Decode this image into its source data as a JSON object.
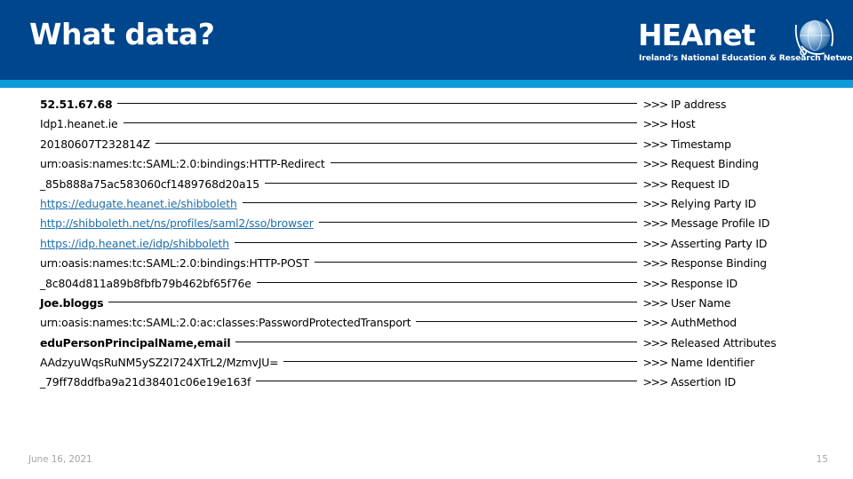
{
  "header": {
    "title": "What data?",
    "background_color": "#00468c",
    "accent_color": "#0d9bd7"
  },
  "logo": {
    "wordmark": "HEAnet",
    "tagline": "Ireland's National Education & Research Network",
    "icon": "globe-icon"
  },
  "rows": [
    {
      "value": "52.51.67.68",
      "style": "bold",
      "arrow": ">>>",
      "label": "IP address"
    },
    {
      "value": "Idp1.heanet.ie",
      "style": "normal",
      "arrow": ">>>",
      "label": "Host"
    },
    {
      "value": "20180607T232814Z",
      "style": "normal",
      "arrow": ">>>",
      "label": "Timestamp"
    },
    {
      "value": "urn:oasis:names:tc:SAML:2.0:bindings:HTTP-Redirect",
      "style": "normal",
      "arrow": ">>>",
      "label": " Request Binding"
    },
    {
      "value": "_85b888a75ac583060cf1489768d20a15",
      "style": "normal",
      "arrow": ">>>",
      "label": "Request ID"
    },
    {
      "value": "https://edugate.heanet.ie/shibboleth",
      "style": "link",
      "arrow": ">>>",
      "label": "Relying Party ID"
    },
    {
      "value": "http://shibboleth.net/ns/profiles/saml2/sso/browser",
      "style": "link",
      "arrow": ">>>",
      "label": "Message Profile ID"
    },
    {
      "value": "https://idp.heanet.ie/idp/shibboleth",
      "style": "link",
      "arrow": ">>>",
      "label": "Asserting Party ID"
    },
    {
      "value": "urn:oasis:names:tc:SAML:2.0:bindings:HTTP-POST",
      "style": "normal",
      "arrow": ">>>",
      "label": "Response Binding"
    },
    {
      "value": "_8c804d811a89b8fbfb79b462bf65f76e",
      "style": "normal",
      "arrow": ">>>",
      "label": "Response ID"
    },
    {
      "value": "Joe.bloggs",
      "style": "bold",
      "arrow": ">>>",
      "label": "User Name"
    },
    {
      "value": "urn:oasis:names:tc:SAML:2.0:ac:classes:PasswordProtectedTransport",
      "style": "normal",
      "arrow": ">>>",
      "label": "AuthMethod"
    },
    {
      "value": "eduPersonPrincipalName,email",
      "style": "bold",
      "arrow": ">>>",
      "label": "Released Attributes"
    },
    {
      "value": "AAdzyuWqsRuNM5ySZ2I724XTrL2/MzmvJU=",
      "style": "normal",
      "arrow": ">>>",
      "label": "Name Identifier"
    },
    {
      "value": "_79ff78ddfba9a21d38401c06e19e163f",
      "style": "normal",
      "arrow": ">>>",
      "label": "Assertion ID"
    }
  ],
  "footer": {
    "date": "June 16, 2021",
    "page_number": "15"
  }
}
